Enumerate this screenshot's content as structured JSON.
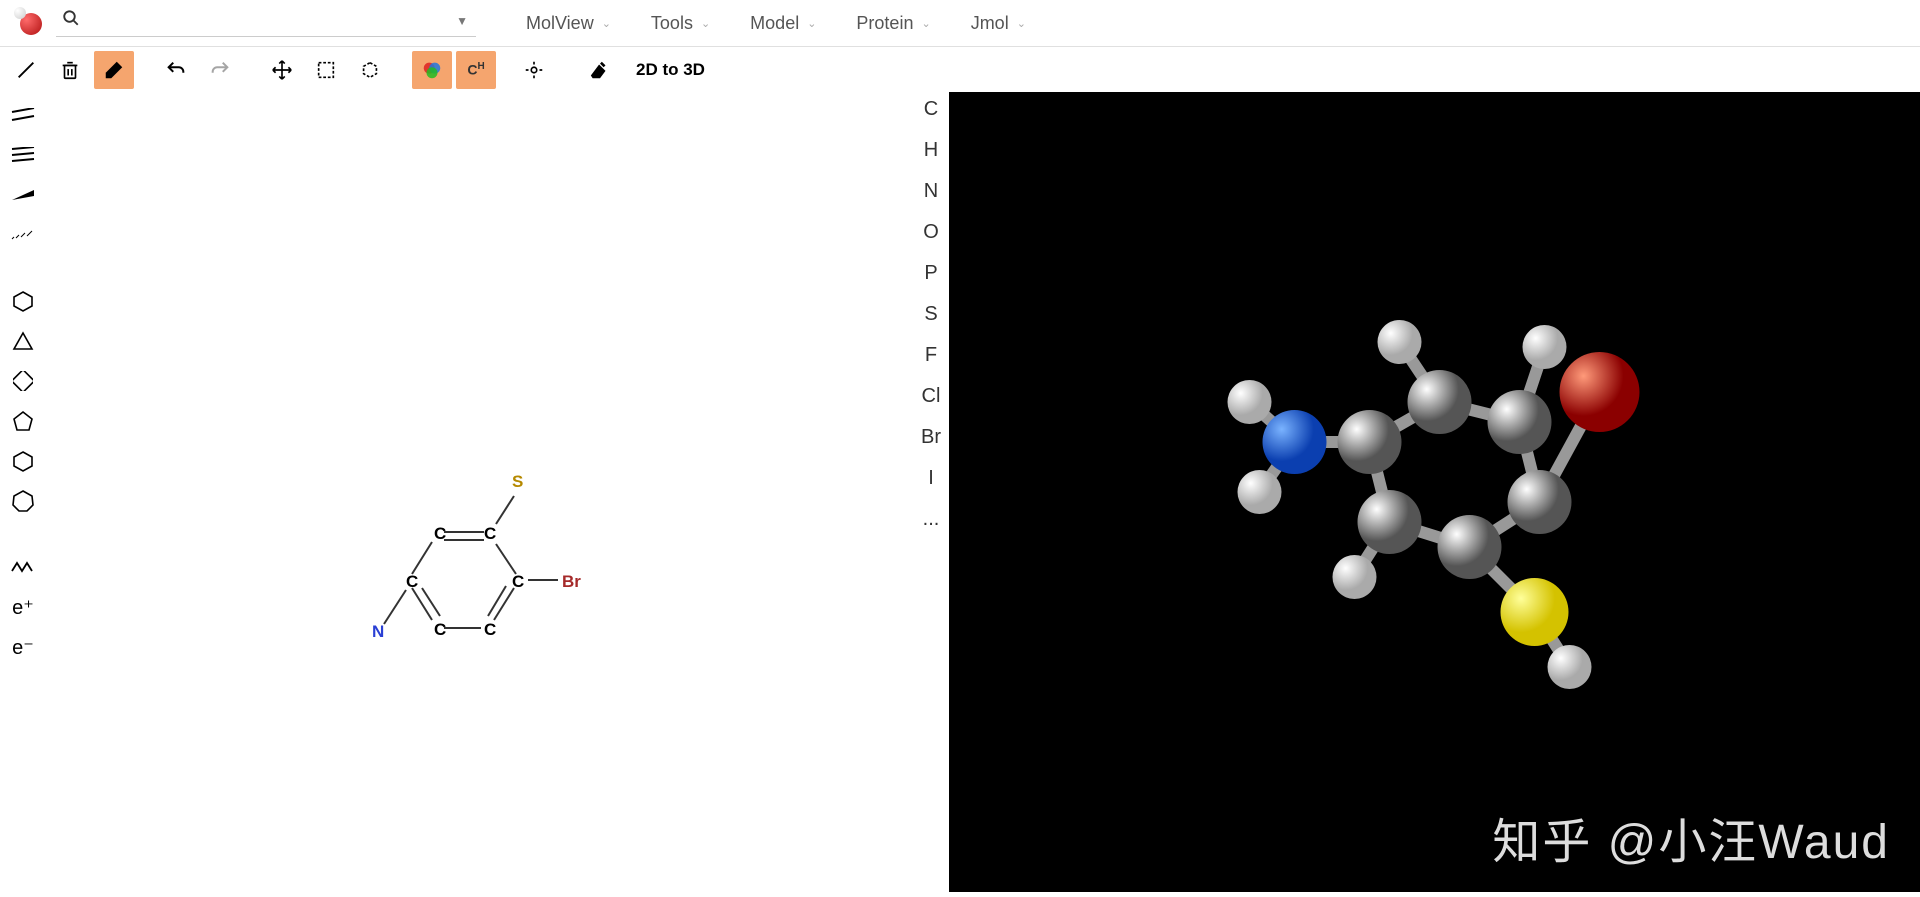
{
  "menu": {
    "molview": "MolView",
    "tools": "Tools",
    "model": "Model",
    "protein": "Protein",
    "jmol": "Jmol"
  },
  "toolbar": {
    "to3d": "2D to 3D",
    "ch_label": "C H"
  },
  "elements": {
    "c": "C",
    "h": "H",
    "n": "N",
    "o": "O",
    "p": "P",
    "s": "S",
    "f": "F",
    "cl": "Cl",
    "br": "Br",
    "i": "I",
    "more": "..."
  },
  "left_labels": {
    "eplus": "e⁺",
    "eminus": "e⁻"
  },
  "atoms2d": {
    "s": "S",
    "c1": "C",
    "c2": "C",
    "c3": "C",
    "c4": "C",
    "c5": "C",
    "c6": "C",
    "br": "Br",
    "n": "N"
  },
  "watermark": "知乎 @小汪Waud",
  "search_placeholder": ""
}
